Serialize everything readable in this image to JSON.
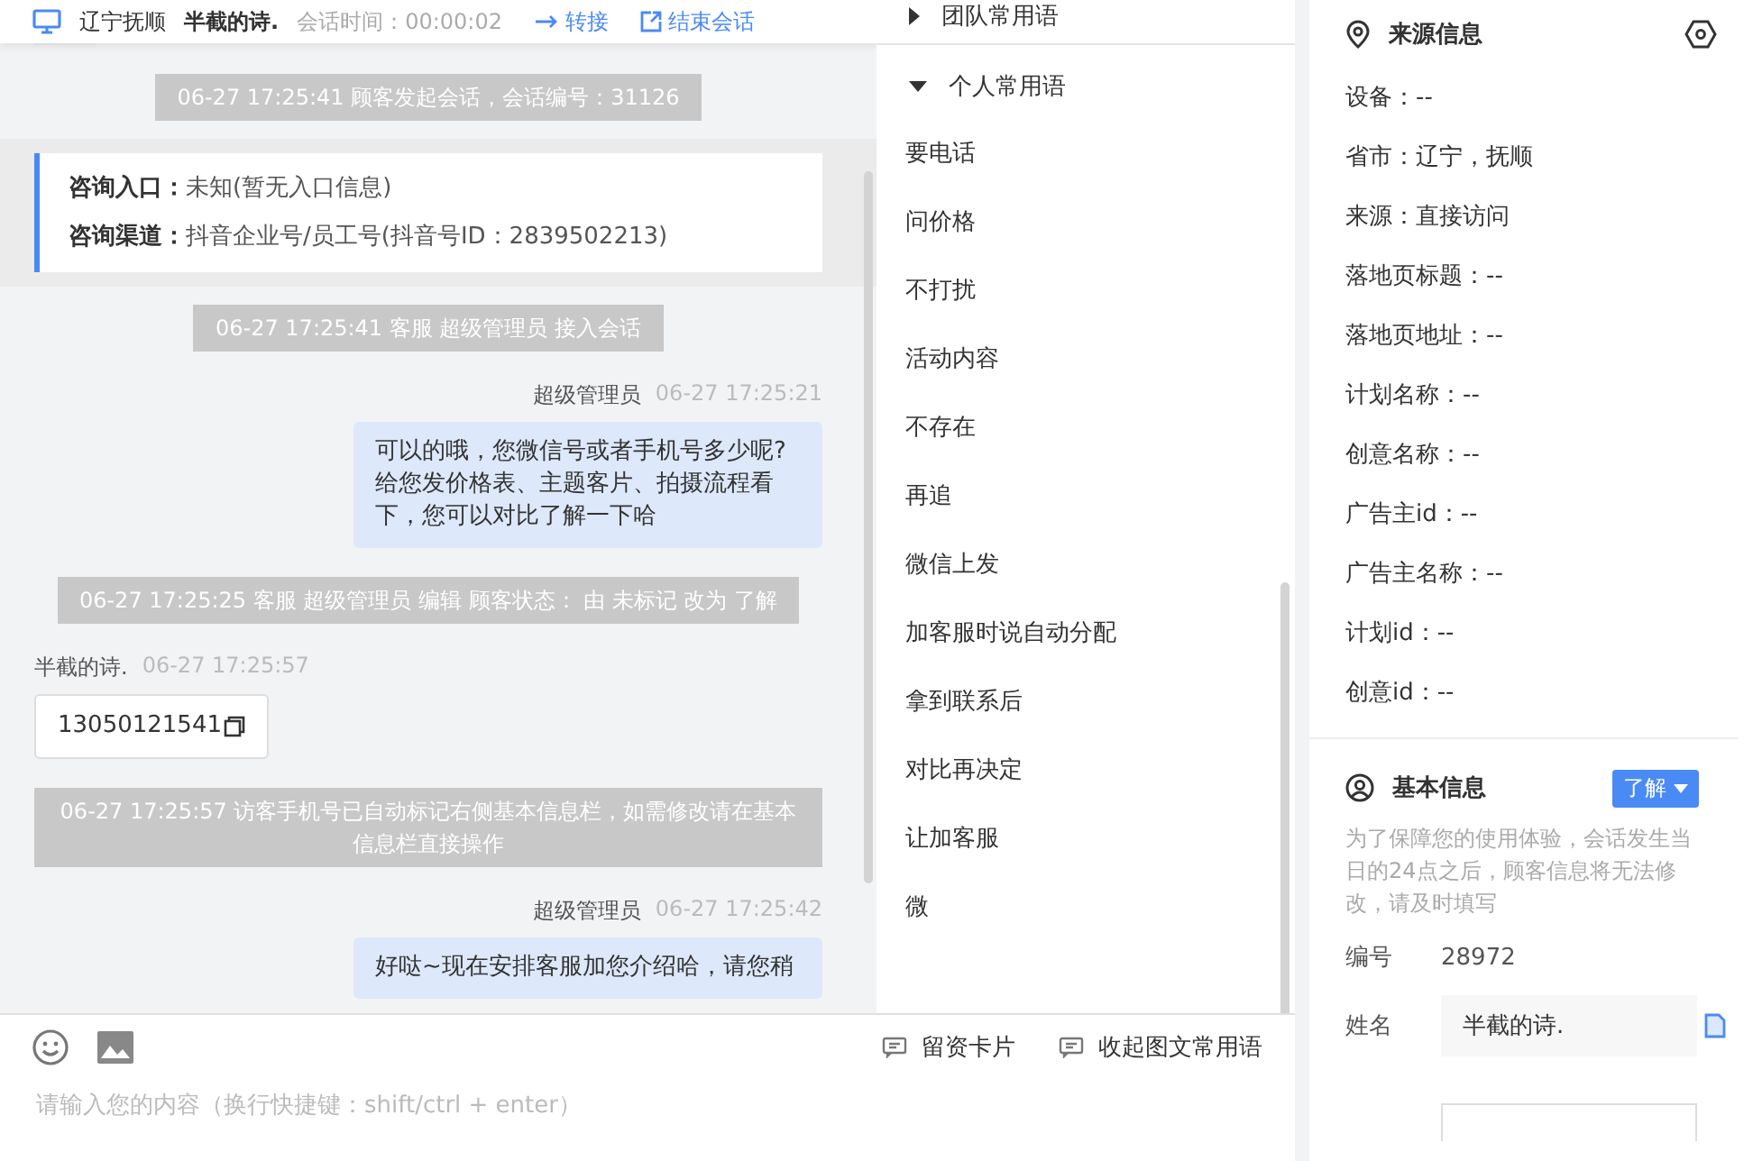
{
  "header": {
    "location": "辽宁抚顺",
    "customer": "半截的诗.",
    "session_time": "会话时间：00:00:02",
    "actions": [
      "转接",
      "结束会话"
    ]
  },
  "messages": [
    {
      "kind": "system",
      "text": "06-27 17:25:41 顾客发起会话，会话编号：31126"
    },
    {
      "kind": "info",
      "rows": [
        {
          "label": "咨询入口：",
          "value": "未知(暂无入口信息)"
        },
        {
          "label": "咨询渠道：",
          "value": "抖音企业号/员工号(抖音号ID：2839502213)"
        }
      ]
    },
    {
      "kind": "system",
      "text": "06-27 17:25:41 客服 超级管理员 接入会话"
    },
    {
      "kind": "agent",
      "sender": "超级管理员",
      "time": "06-27 17:25:21",
      "text": "可以的哦，您微信号或者手机号多少呢?给您发价格表、主题客片、拍摄流程看下，您可以对比了解一下哈"
    },
    {
      "kind": "system",
      "text": "06-27 17:25:25 客服 超级管理员 编辑 顾客状态： 由 未标记 改为 了解"
    },
    {
      "kind": "customer",
      "sender": "半截的诗.",
      "time": "06-27 17:25:57",
      "text": "13050121541"
    },
    {
      "kind": "system",
      "text": "06-27 17:25:57 访客手机号已自动标记右侧基本信息栏，如需修改请在基本信息栏直接操作"
    },
    {
      "kind": "agent",
      "sender": "超级管理员",
      "time": "06-27 17:25:42",
      "text": "好哒~现在安排客服加您介绍哈，请您稍"
    }
  ],
  "input": {
    "placeholder": "请输入您的内容（换行快捷键：shift/ctrl + enter）",
    "actions": [
      "留资卡片",
      "收起图文常用语"
    ]
  },
  "phrases": {
    "groups": [
      {
        "title": "团队常用语",
        "expanded": false
      },
      {
        "title": "个人常用语",
        "expanded": true
      }
    ],
    "items": [
      "要电话",
      "问价格",
      "不打扰",
      "活动内容",
      "不存在",
      "再追",
      "微信上发",
      "加客服时说自动分配",
      "拿到联系后",
      "对比再决定",
      "让加客服",
      "微"
    ]
  },
  "source_info": {
    "title": "来源信息",
    "fields": [
      "设备：--",
      "省市：辽宁，抚顺",
      "来源：直接访问",
      "落地页标题：--",
      "落地页地址：--",
      "计划名称：--",
      "创意名称：--",
      "广告主id：--",
      "广告主名称：--",
      "计划id：--",
      "创意id：--"
    ]
  },
  "basic_info": {
    "title": "基本信息",
    "status": "了解",
    "notice": "为了保障您的使用体验，会话发生当日的24点之后，顾客信息将无法修改，请及时填写",
    "number_label": "编号",
    "number": "28972",
    "name_label": "姓名",
    "name_value": "半截的诗."
  }
}
